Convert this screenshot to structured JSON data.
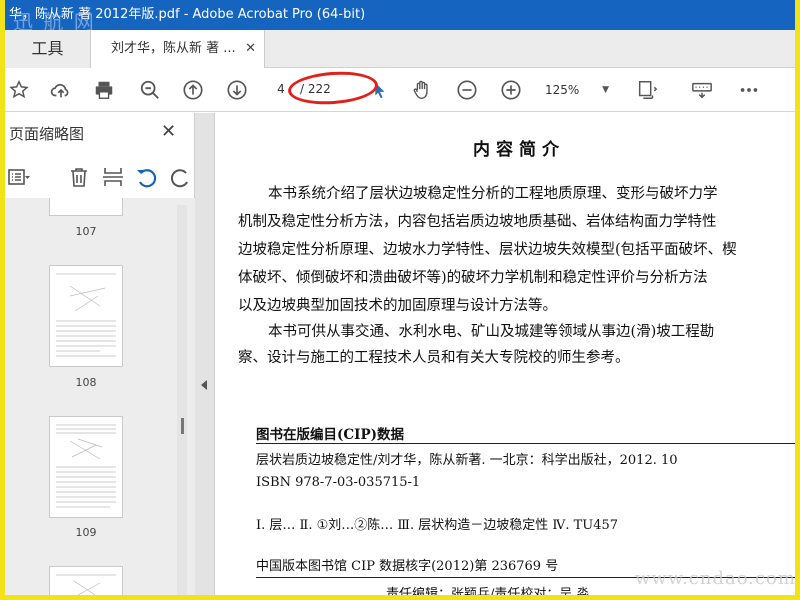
{
  "window": {
    "title": "华，陈从新 著 2012年版.pdf - Adobe Acrobat Pro (64-bit)"
  },
  "watermark_top": "迅 航 网",
  "tabs": {
    "tools_label": "工具",
    "doc_label": "刘才华，陈从新 著 ...",
    "close_glyph": "✕"
  },
  "toolbar": {
    "page_current": "4",
    "page_total": "/ 222",
    "zoom": "125%"
  },
  "panel": {
    "title": "页面缩略图",
    "close_glyph": "✕"
  },
  "thumbnails": [
    {
      "label": "107"
    },
    {
      "label": "108"
    },
    {
      "label": "109"
    }
  ],
  "document": {
    "heading": "内容简介",
    "paragraphs": [
      "本书系统介绍了层状边坡稳定性分析的工程地质原理、变形与破坏力学",
      "机制及稳定性分析方法，内容包括岩质边坡地质基础、岩体结构面力学特性",
      "边坡稳定性分析原理、边坡水力学特性、层状边坡失效模型(包括平面破坏、楔",
      "体破坏、倾倒破坏和溃曲破坏等)的破坏力学机制和稳定性评价与分析方法",
      "以及边坡典型加固技术的加固原理与设计方法等。",
      "本书可供从事交通、水利水电、矿山及城建等领域从事边(滑)坡工程勘",
      "察、设计与施工的工程技术人员和有关大专院校的师生参考。"
    ],
    "cip_title": "图书在版编目(CIP)数据",
    "cip_lines": [
      "层状岩质边坡稳定性/刘才华，陈从新著. 一北京：科学出版社，2012. 10",
      "ISBN 978-7-03-035715-1",
      "Ⅰ. 层…  Ⅱ. ①刘…②陈…  Ⅲ. 层状构造－边坡稳定性  Ⅳ. TU457",
      "中国版本图书馆 CIP 数据核字(2012)第 236769 号",
      "责任编辑：张颖兵/责任校对：吴  淼"
    ]
  },
  "watermark_bottom": "www.cndao.com"
}
